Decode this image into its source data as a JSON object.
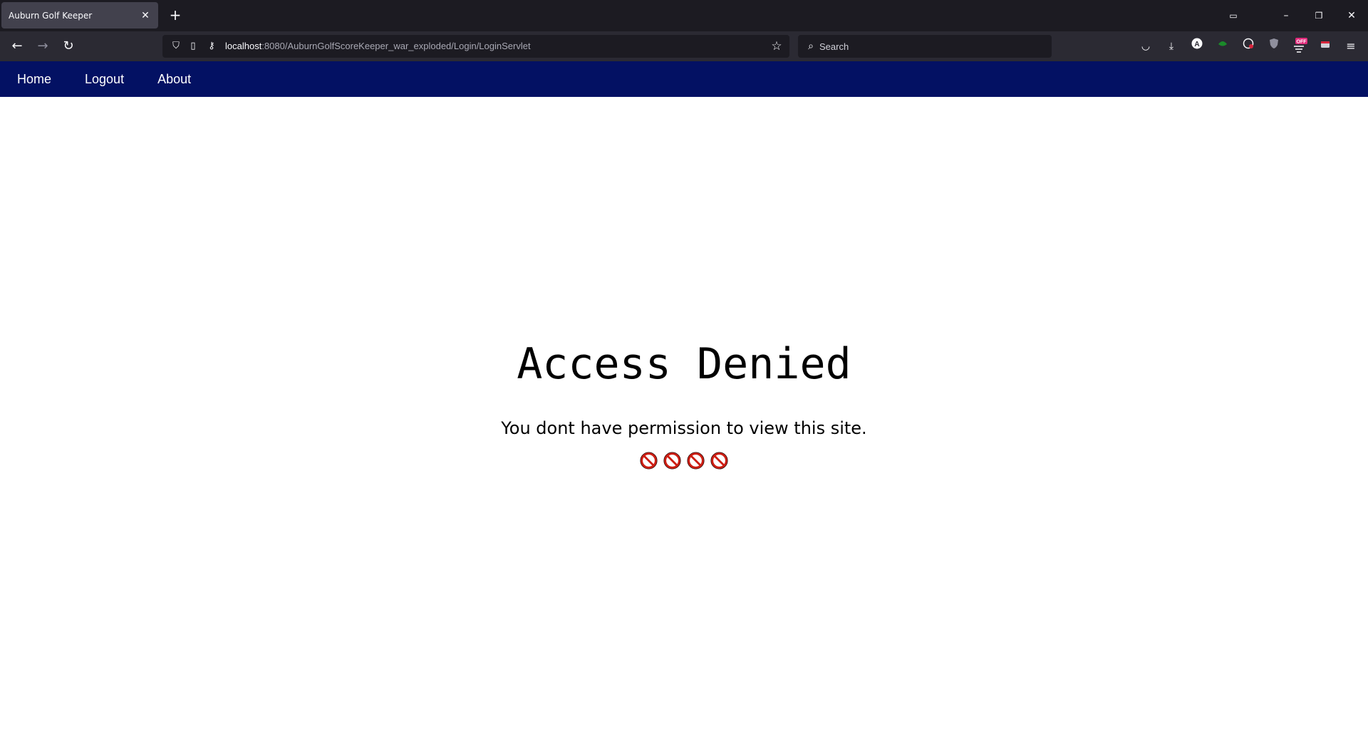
{
  "browser": {
    "tab_title": "Auburn Golf Keeper",
    "url_host": "localhost",
    "url_rest": ":8080/AuburnGolfScoreKeeper_war_exploded/Login/LoginServlet",
    "search_placeholder": "Search"
  },
  "site_nav": {
    "home": "Home",
    "logout": "Logout",
    "about": "About"
  },
  "main": {
    "heading": "Access Denied",
    "message": "You dont have permission to view this site.",
    "icon_count": 4
  },
  "colors": {
    "nav_background": "#031163",
    "icon_red": "#cc1d12"
  }
}
